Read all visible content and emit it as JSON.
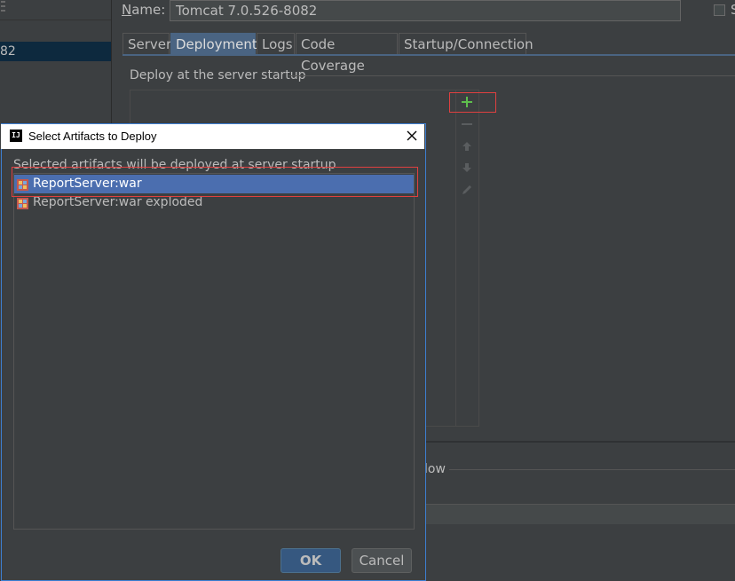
{
  "left_panel": {
    "selected_item_label": "82"
  },
  "config": {
    "name_label": "Name:",
    "name_mnemonic": "N",
    "name_rest": "ame:",
    "name_value": "Tomcat 7.0.526-8082",
    "share_label": "S"
  },
  "tabs": [
    {
      "label": "Server",
      "active": false
    },
    {
      "label": "Deployment",
      "active": true
    },
    {
      "label": "Logs",
      "active": false
    },
    {
      "label": "Code Coverage",
      "active": false
    },
    {
      "label": "Startup/Connection",
      "active": false
    }
  ],
  "deployment": {
    "section_label": "Deploy at the server startup",
    "add_icon": "plus-icon",
    "remove_icon": "minus-icon",
    "up_icon": "arrow-up-icon",
    "down_icon": "arrow-down-icon",
    "edit_icon": "pencil-icon",
    "before_launch_fragment": "low"
  },
  "dialog": {
    "title": "Select Artifacts to Deploy",
    "hint": "Selected artifacts will be deployed at server startup",
    "artifacts": [
      {
        "label": "ReportServer:war",
        "selected": true
      },
      {
        "label": "ReportServer:war exploded",
        "selected": false
      }
    ],
    "ok_label": "OK",
    "cancel_label": "Cancel"
  },
  "colors": {
    "background": "#3c3f41",
    "selection": "#4b6eaf",
    "active_tab": "#4a6482",
    "highlight_box": "#e04040",
    "add_green": "#5ebe4d"
  }
}
